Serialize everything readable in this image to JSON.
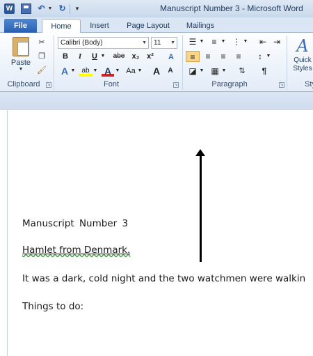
{
  "title_bar": {
    "window_title": "Manuscript Number 3  -  Microsoft Word",
    "app_icon_letter": "W"
  },
  "tabs": {
    "file": "File",
    "home": "Home",
    "insert": "Insert",
    "page_layout": "Page Layout",
    "mailings": "Mailings"
  },
  "clipboard": {
    "paste_label": "Paste",
    "group_label": "Clipboard"
  },
  "font": {
    "font_name": "Calibri (Body)",
    "font_size": "11",
    "bold": "B",
    "italic": "I",
    "underline": "U",
    "strikethrough": "abe",
    "subscript": "x₂",
    "superscript": "x²",
    "grow_font": "A",
    "shrink_font": "A",
    "change_case": "Aa",
    "highlight": "ab",
    "font_color": "A",
    "text_effects": "A",
    "group_label": "Font"
  },
  "paragraph": {
    "group_label": "Paragraph",
    "pilcrow": "¶"
  },
  "styles": {
    "quick_styles_label": "Quick Styles",
    "quick_styles_glyph": "A",
    "group_label_partial": "Sty"
  },
  "colors": {
    "accent_blue": "#2a5fb0",
    "highlight_yellow": "#ffff00",
    "font_color_red": "#e02020",
    "selected_button": "#f8d58a"
  },
  "document": {
    "lines": [
      "Manuscript Number 3",
      "Hamlet from Denmark.",
      "It was a dark, cold night and the two watchmen were walkin",
      "Things to do:"
    ]
  }
}
